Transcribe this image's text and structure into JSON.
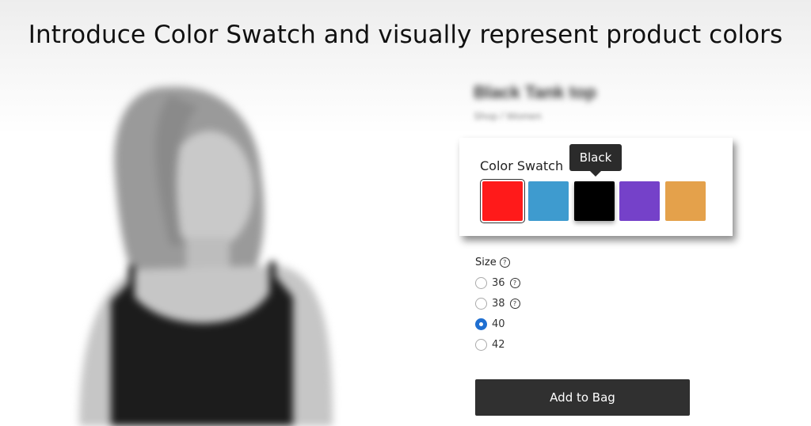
{
  "headline": "Introduce Color Swatch and visually represent product colors",
  "product": {
    "title": "Black Tank top",
    "breadcrumb": "Shop / Women"
  },
  "swatch": {
    "label": "Color Swatch",
    "tooltip": "Black",
    "colors": [
      {
        "name": "Red",
        "hex": "#ff1a1a",
        "selected": true
      },
      {
        "name": "Blue",
        "hex": "#3e9bcf",
        "selected": false
      },
      {
        "name": "Black",
        "hex": "#000000",
        "selected": false
      },
      {
        "name": "Purple",
        "hex": "#7541c9",
        "selected": false
      },
      {
        "name": "Orange",
        "hex": "#e4a14b",
        "selected": false
      }
    ]
  },
  "size": {
    "label": "Size",
    "options": [
      {
        "value": "36",
        "checked": false,
        "help": true
      },
      {
        "value": "38",
        "checked": false,
        "help": true
      },
      {
        "value": "40",
        "checked": true,
        "help": false
      },
      {
        "value": "42",
        "checked": false,
        "help": false
      }
    ]
  },
  "cta": {
    "add_to_bag": "Add to Bag"
  },
  "icons": {
    "help": "question-circle-icon"
  }
}
